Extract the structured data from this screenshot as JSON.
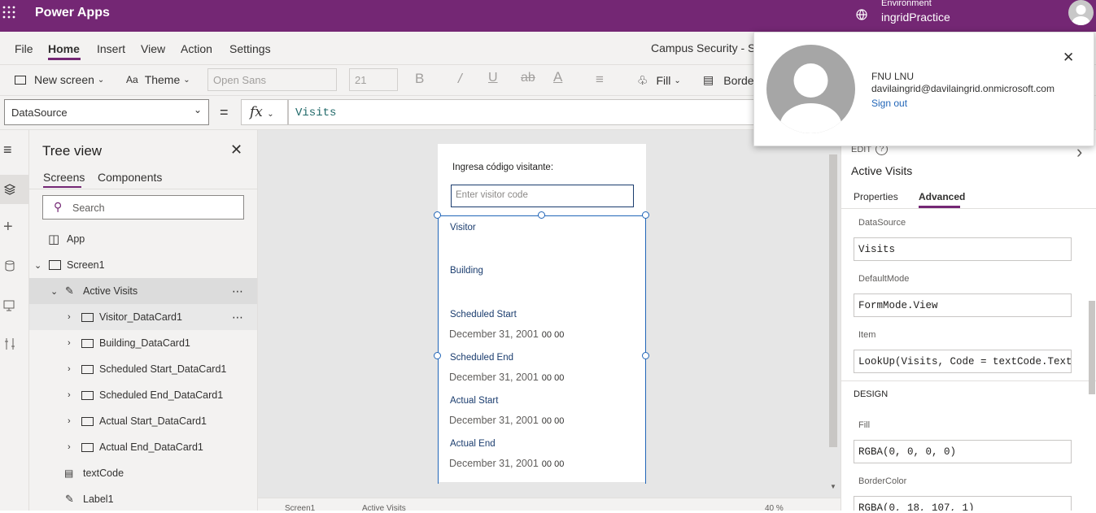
{
  "app": {
    "title": "Power Apps",
    "environment_label": "Environment",
    "environment_name": "ingridPractice"
  },
  "menu": {
    "items": [
      "File",
      "Home",
      "Insert",
      "View",
      "Action",
      "Settings"
    ],
    "active": "Home",
    "doc_title": "Campus Security - Sa"
  },
  "ribbon": {
    "new_screen": "New screen",
    "theme": "Theme",
    "font": "Open Sans",
    "font_size": "21",
    "bold": "B",
    "fill": "Fill",
    "border": "Borde"
  },
  "formula": {
    "property": "DataSource",
    "equals": "=",
    "fx": "fx",
    "value": "Visits"
  },
  "tree": {
    "title": "Tree view",
    "tabs": [
      "Screens",
      "Components"
    ],
    "search_placeholder": "Search",
    "items": [
      {
        "label": "App"
      },
      {
        "label": "Screen1"
      },
      {
        "label": "Active Visits"
      },
      {
        "label": "Visitor_DataCard1"
      },
      {
        "label": "Building_DataCard1"
      },
      {
        "label": "Scheduled Start_DataCard1"
      },
      {
        "label": "Scheduled End_DataCard1"
      },
      {
        "label": "Actual Start_DataCard1"
      },
      {
        "label": "Actual End_DataCard1"
      },
      {
        "label": "textCode"
      },
      {
        "label": "Label1"
      }
    ]
  },
  "canvas": {
    "prompt": "Ingresa código visitante:",
    "input_placeholder": "Enter visitor code",
    "cards": [
      {
        "label": "Visitor",
        "value": ""
      },
      {
        "label": "Building",
        "value": ""
      },
      {
        "label": "Scheduled Start",
        "value": "December 31, 2001",
        "time": "00  00"
      },
      {
        "label": "Scheduled End",
        "value": "December 31, 2001",
        "time": "00  00"
      },
      {
        "label": "Actual Start",
        "value": "December 31, 2001",
        "time": "00  00"
      },
      {
        "label": "Actual End",
        "value": "December 31, 2001",
        "time": "00  00"
      }
    ]
  },
  "popup": {
    "name": "FNU LNU",
    "email": "davilaingrid@davilaingrid.onmicrosoft.com",
    "signout": "Sign out"
  },
  "props": {
    "edit_label": "EDIT",
    "control_name": "Active Visits",
    "tabs": [
      "Properties",
      "Advanced"
    ],
    "datasource_label": "DataSource",
    "datasource_value": "Visits",
    "defaultmode_label": "DefaultMode",
    "defaultmode_value": "FormMode.View",
    "item_label": "Item",
    "item_value": "LookUp(Visits, Code = textCode.Text)",
    "design_label": "DESIGN",
    "fill_label": "Fill",
    "fill_value": "RGBA(0, 0, 0, 0)",
    "bordercolor_label": "BorderColor",
    "bordercolor_value": "RGBA(0, 18, 107, 1)"
  },
  "status": {
    "screen": "Screen1",
    "control": "Active Visits",
    "zoom": "40 %"
  },
  "colors": {
    "brand": "#742774",
    "accent": "#2266b8"
  }
}
